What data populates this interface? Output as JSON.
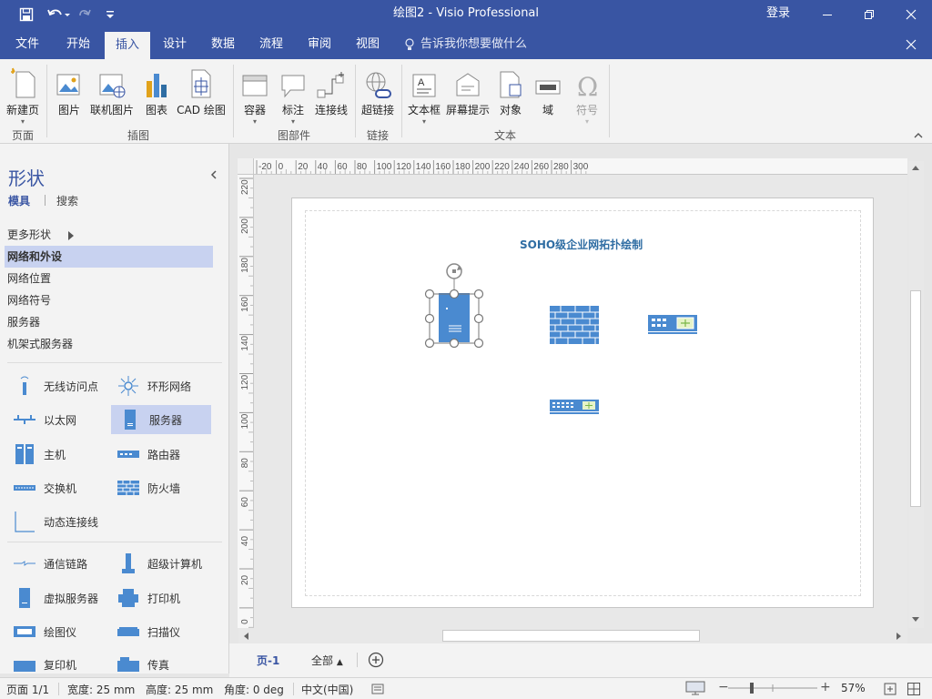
{
  "titlebar": {
    "title": "绘图2 - Visio Professional",
    "login": "登录",
    "icons": [
      "save-icon",
      "undo-icon",
      "redo-icon",
      "customize-icon",
      "minimize-icon",
      "restore-icon",
      "close-icon"
    ]
  },
  "tabs": [
    {
      "label": "文件"
    },
    {
      "label": "开始"
    },
    {
      "label": "插入"
    },
    {
      "label": "设计"
    },
    {
      "label": "数据"
    },
    {
      "label": "流程"
    },
    {
      "label": "审阅"
    },
    {
      "label": "视图"
    }
  ],
  "tell_me": "告诉我你想要做什么",
  "ribbon": {
    "groups": {
      "page": "页面",
      "illustrations": "插图",
      "diagram_parts": "图部件",
      "links": "链接",
      "text": "文本"
    },
    "buttons": {
      "new_page": "新建页",
      "picture": "图片",
      "online_picture": "联机图片",
      "chart": "图表",
      "cad": "CAD 绘图",
      "container": "容器",
      "callout": "标注",
      "connector": "连接线",
      "hyperlink": "超链接",
      "textbox": "文本框",
      "screentip": "屏幕提示",
      "object": "对象",
      "field": "域",
      "symbol": "符号"
    }
  },
  "shapes_panel": {
    "title": "形状",
    "tab_stencils": "模具",
    "tab_search": "搜索",
    "more_shapes": "更多形状",
    "stencils": [
      "网络和外设",
      "网络位置",
      "网络符号",
      "服务器",
      "机架式服务器"
    ],
    "items": [
      {
        "label": "无线访问点"
      },
      {
        "label": "环形网络"
      },
      {
        "label": "以太网"
      },
      {
        "label": "服务器"
      },
      {
        "label": "主机"
      },
      {
        "label": "路由器"
      },
      {
        "label": "交换机"
      },
      {
        "label": "防火墙"
      },
      {
        "label": "动态连接线"
      },
      {
        "label": "通信链路"
      },
      {
        "label": "超级计算机"
      },
      {
        "label": "虚拟服务器"
      },
      {
        "label": "打印机"
      },
      {
        "label": "绘图仪"
      },
      {
        "label": "扫描仪"
      },
      {
        "label": "复印机"
      },
      {
        "label": "传真"
      }
    ]
  },
  "ruler": {
    "top_ticks": [
      "-20",
      "0",
      "20",
      "40",
      "60",
      "80",
      "100",
      "120",
      "140",
      "160",
      "180",
      "200",
      "220",
      "240",
      "260",
      "280",
      "300"
    ],
    "left_ticks": [
      "220",
      "200",
      "180",
      "160",
      "140",
      "120",
      "100",
      "80",
      "60",
      "40",
      "20",
      "0"
    ]
  },
  "canvas": {
    "title": "SOHO级企业网拓扑绘制"
  },
  "page_tabs": {
    "current": "页-1",
    "all": "全部"
  },
  "status": {
    "page": "页面 1/1",
    "width": "宽度: 25 mm",
    "height": "高度: 25 mm",
    "angle": "角度: 0 deg",
    "language": "中文(中国)",
    "zoom": "57%"
  },
  "colors": {
    "brand": "#3955a3",
    "shape_blue": "#4a8ad0",
    "selected_stencil": "#c8d2f0"
  }
}
